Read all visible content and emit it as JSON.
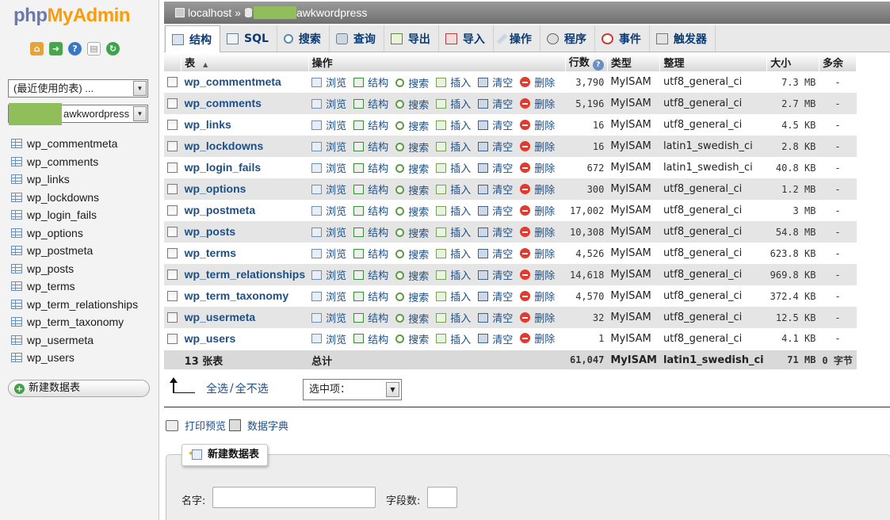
{
  "app": {
    "logo_part1": "php",
    "logo_part2": "MyAdmin"
  },
  "sidebar": {
    "recent_select": "(最近使用的表) ...",
    "db_select": "awkwordpress",
    "tables": [
      "wp_commentmeta",
      "wp_comments",
      "wp_links",
      "wp_lockdowns",
      "wp_login_fails",
      "wp_options",
      "wp_postmeta",
      "wp_posts",
      "wp_terms",
      "wp_term_relationships",
      "wp_term_taxonomy",
      "wp_usermeta",
      "wp_users"
    ],
    "new_table": "新建数据表"
  },
  "breadcrumb": {
    "server": "localhost",
    "separator": "»",
    "db": "awkwordpress"
  },
  "tabs": [
    "结构",
    "SQL",
    "搜索",
    "查询",
    "导出",
    "导入",
    "操作",
    "程序",
    "事件",
    "触发器"
  ],
  "columns": {
    "table": "表",
    "action": "操作",
    "rows": "行数",
    "type": "类型",
    "collation": "整理",
    "size": "大小",
    "overhead": "多余"
  },
  "actions": {
    "browse": "浏览",
    "structure": "结构",
    "search": "搜索",
    "insert": "插入",
    "empty": "清空",
    "drop": "删除"
  },
  "rows": [
    {
      "name": "wp_commentmeta",
      "rows": "3,790",
      "type": "MyISAM",
      "collation": "utf8_general_ci",
      "size": "7.3 MB",
      "overhead": "-"
    },
    {
      "name": "wp_comments",
      "rows": "5,196",
      "type": "MyISAM",
      "collation": "utf8_general_ci",
      "size": "2.7 MB",
      "overhead": "-"
    },
    {
      "name": "wp_links",
      "rows": "16",
      "type": "MyISAM",
      "collation": "utf8_general_ci",
      "size": "4.5 KB",
      "overhead": "-"
    },
    {
      "name": "wp_lockdowns",
      "rows": "16",
      "type": "MyISAM",
      "collation": "latin1_swedish_ci",
      "size": "2.8 KB",
      "overhead": "-"
    },
    {
      "name": "wp_login_fails",
      "rows": "672",
      "type": "MyISAM",
      "collation": "latin1_swedish_ci",
      "size": "40.8 KB",
      "overhead": "-"
    },
    {
      "name": "wp_options",
      "rows": "300",
      "type": "MyISAM",
      "collation": "utf8_general_ci",
      "size": "1.2 MB",
      "overhead": "-"
    },
    {
      "name": "wp_postmeta",
      "rows": "17,002",
      "type": "MyISAM",
      "collation": "utf8_general_ci",
      "size": "3 MB",
      "overhead": "-"
    },
    {
      "name": "wp_posts",
      "rows": "10,308",
      "type": "MyISAM",
      "collation": "utf8_general_ci",
      "size": "54.8 MB",
      "overhead": "-"
    },
    {
      "name": "wp_terms",
      "rows": "4,526",
      "type": "MyISAM",
      "collation": "utf8_general_ci",
      "size": "623.8 KB",
      "overhead": "-"
    },
    {
      "name": "wp_term_relationships",
      "rows": "14,618",
      "type": "MyISAM",
      "collation": "utf8_general_ci",
      "size": "969.8 KB",
      "overhead": "-"
    },
    {
      "name": "wp_term_taxonomy",
      "rows": "4,570",
      "type": "MyISAM",
      "collation": "utf8_general_ci",
      "size": "372.4 KB",
      "overhead": "-"
    },
    {
      "name": "wp_usermeta",
      "rows": "32",
      "type": "MyISAM",
      "collation": "utf8_general_ci",
      "size": "12.5 KB",
      "overhead": "-"
    },
    {
      "name": "wp_users",
      "rows": "1",
      "type": "MyISAM",
      "collation": "utf8_general_ci",
      "size": "4.1 KB",
      "overhead": "-"
    }
  ],
  "footer": {
    "count": "13 张表",
    "total_label": "总计",
    "rows": "61,047",
    "type": "MyISAM",
    "collation": "latin1_swedish_ci",
    "size": "71 MB",
    "overhead": "0 字节"
  },
  "bulk": {
    "check_all": "全选",
    "separator": "/",
    "uncheck_all": "全不选",
    "with_selected": "选中项："
  },
  "links": {
    "print": "打印预览",
    "dictionary": "数据字典"
  },
  "create": {
    "legend": "新建数据表",
    "name_label": "名字:",
    "fields_label": "字段数:"
  },
  "colors": {
    "link": "#1d4f86",
    "mask": "#8fbe5a"
  }
}
